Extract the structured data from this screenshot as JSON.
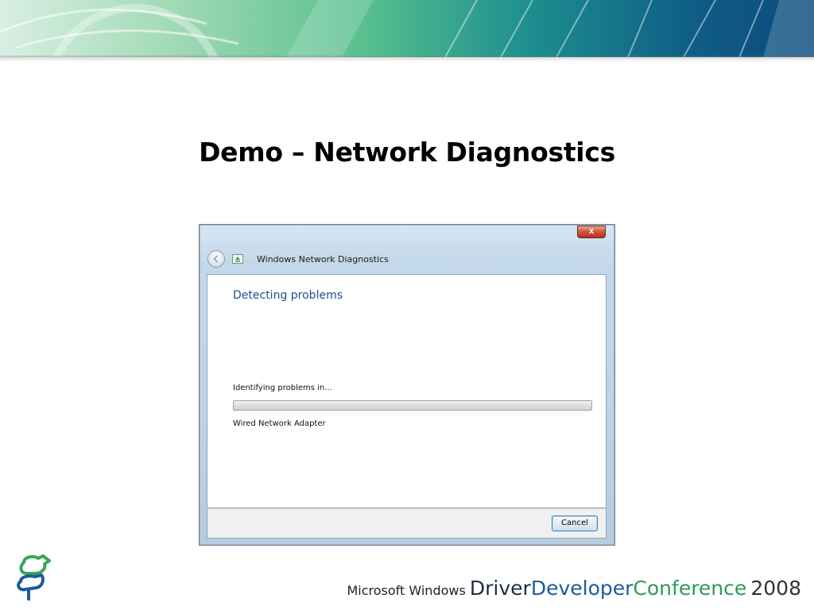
{
  "slide": {
    "title": "Demo – Network Diagnostics"
  },
  "dialog": {
    "window_title": "Windows Network Diagnostics",
    "close_label": "x",
    "heading": "Detecting problems",
    "status_text": "Identifying problems in...",
    "progress_fraction": 0.0,
    "item_text": "Wired Network Adapter",
    "cancel_label": "Cancel"
  },
  "branding": {
    "microsoft_windows": "Microsoft Windows",
    "driver": "Driver",
    "developer": "Developer",
    "conference": "Conference",
    "year": "2008"
  },
  "colors": {
    "heading_blue": "#1e4f8f",
    "developer_blue": "#1c5c9c",
    "conference_green": "#2e9a5a",
    "close_red": "#d0533a"
  },
  "icons": {
    "back": "back-arrow-icon",
    "app": "network-diagnostics-icon",
    "corner_logo": "conference-logo-icon"
  }
}
